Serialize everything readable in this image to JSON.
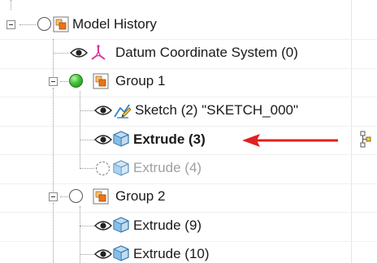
{
  "tree": {
    "root": {
      "label": "Model History"
    },
    "datum": {
      "label": "Datum Coordinate System (0)"
    },
    "group1": {
      "label": "Group 1"
    },
    "sketch": {
      "label": "Sketch (2) \"SKETCH_000\""
    },
    "extrude3": {
      "label": "Extrude (3)"
    },
    "extrude4": {
      "label": "Extrude (4)"
    },
    "group2": {
      "label": "Group 2"
    },
    "extrude9": {
      "label": "Extrude (9)"
    },
    "extrude10": {
      "label": "Extrude (10)"
    }
  },
  "annotation": {
    "arrow_color": "#e02020"
  },
  "icons": {
    "visibility": "eye-icon",
    "group": "group-folder-icon",
    "datum": "datum-coordinate-icon",
    "sketch": "sketch-icon",
    "extrude": "extrude-icon",
    "dependency": "dependency-icon"
  },
  "colors": {
    "active_state": "#2fb52a",
    "group_icon_orange": "#e8741a",
    "datum_magenta": "#d8329a",
    "extrude_blue": "#2f83c8"
  }
}
